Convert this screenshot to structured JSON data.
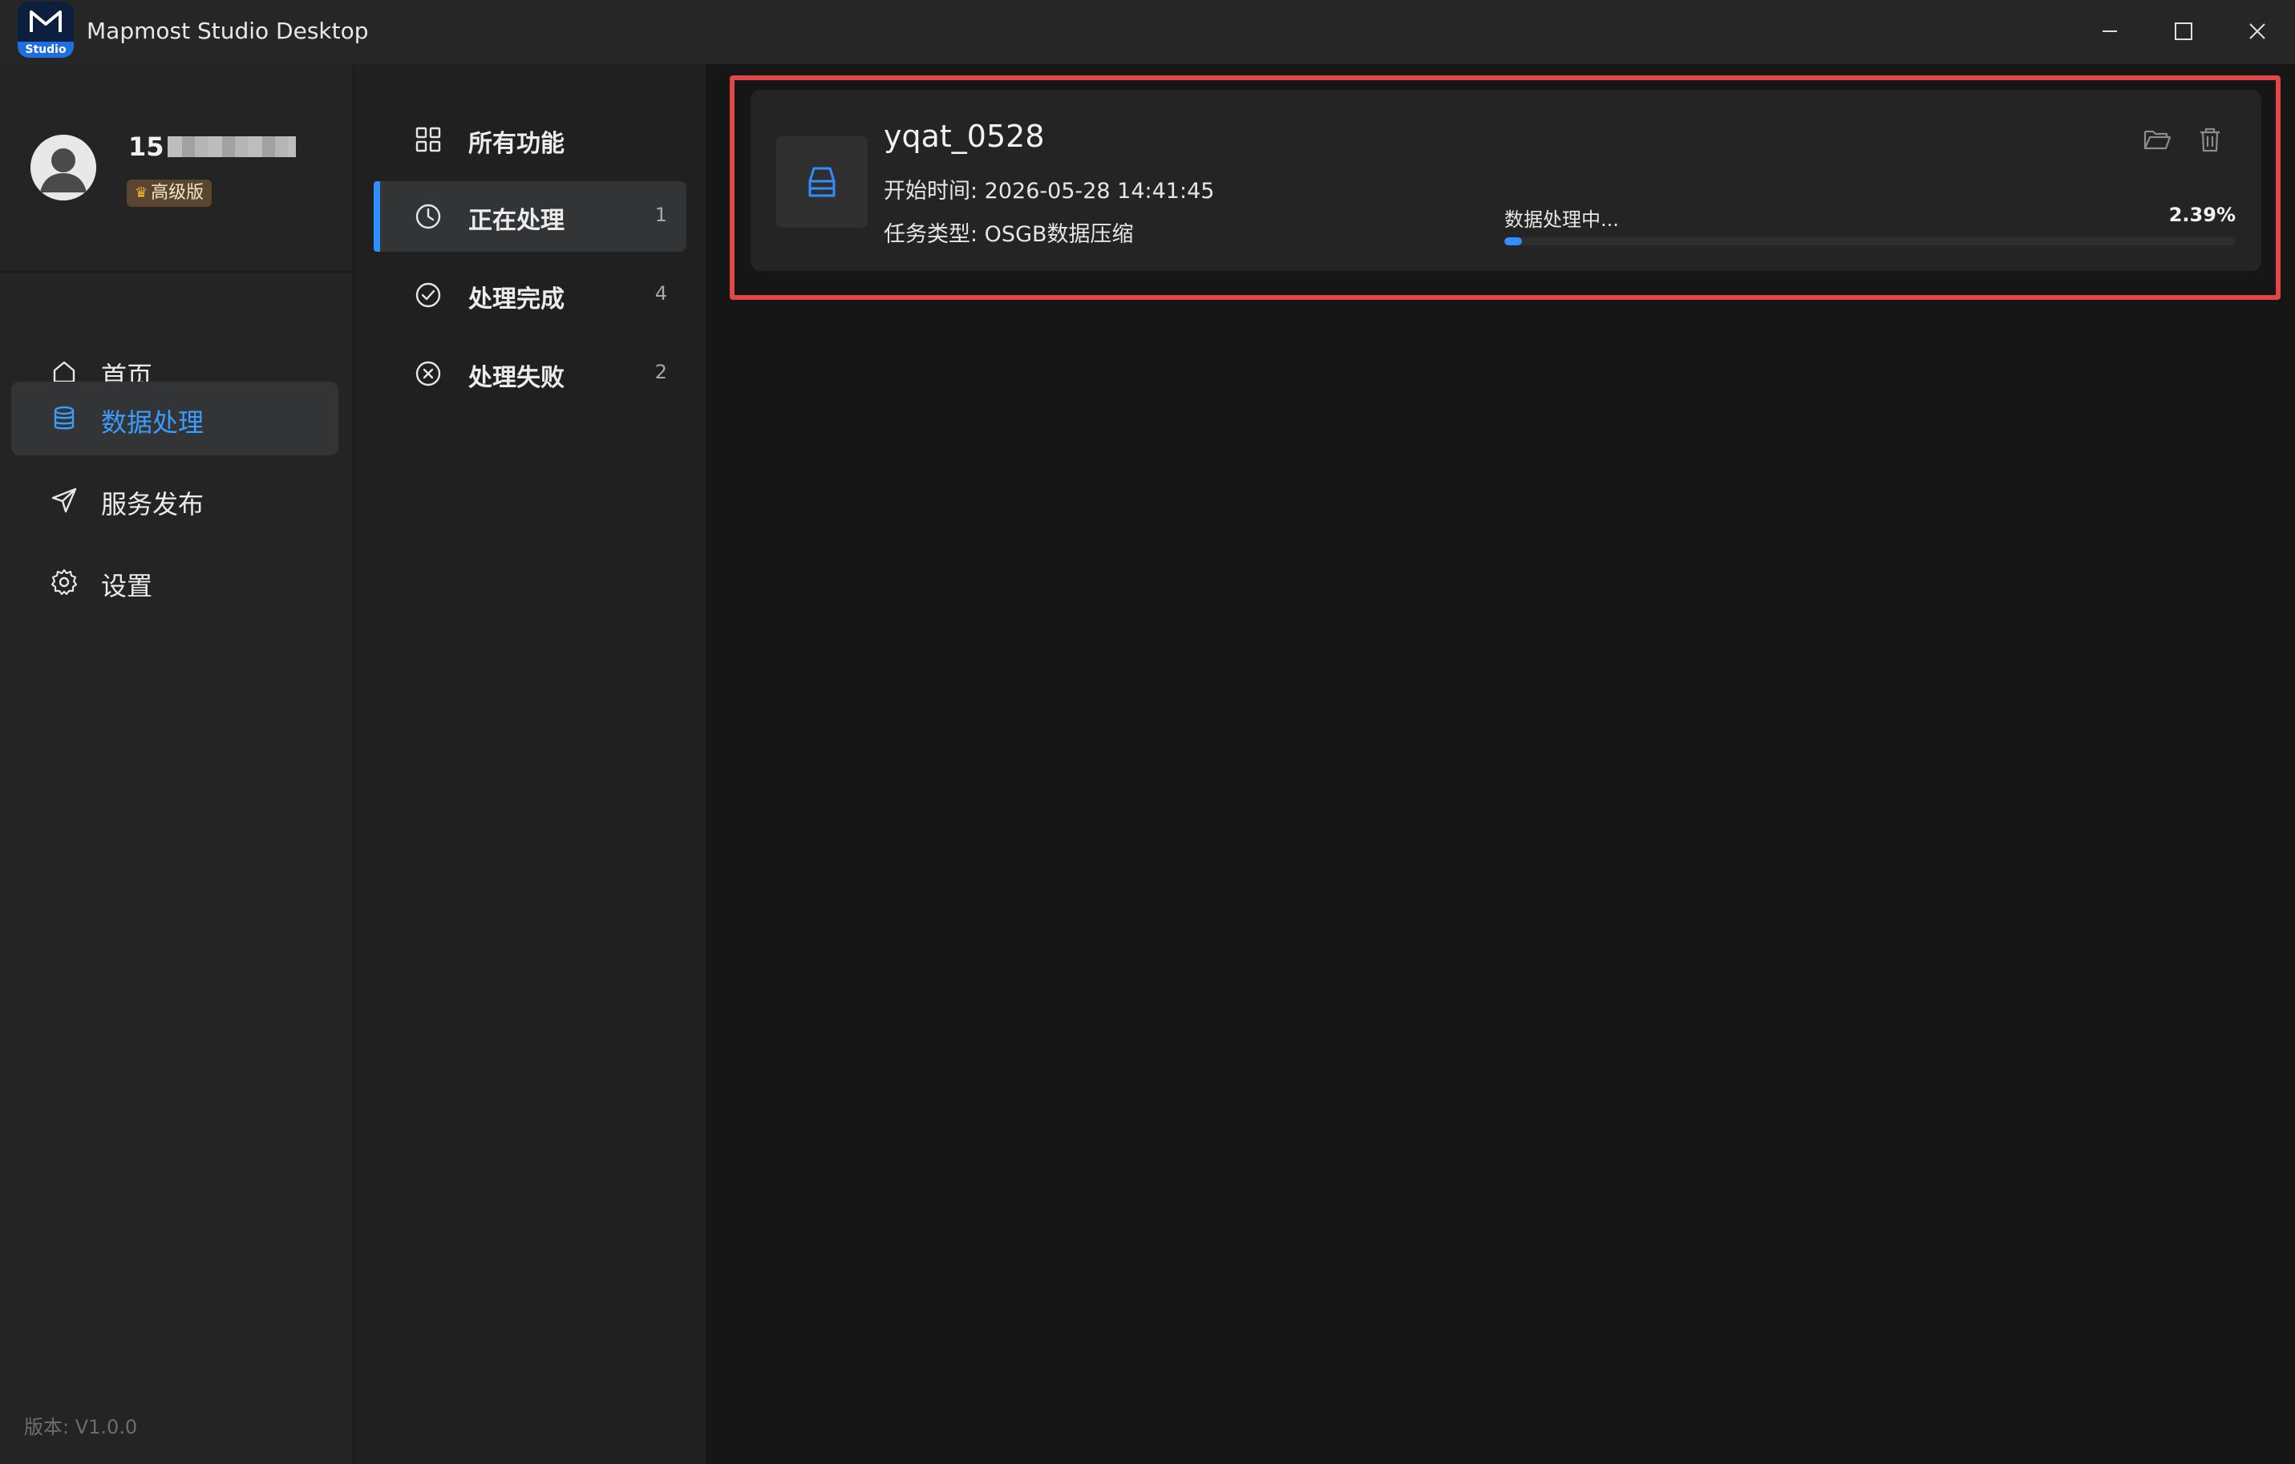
{
  "titlebar": {
    "app_title": "Mapmost Studio Desktop",
    "logo_tag": "Studio"
  },
  "user": {
    "name_prefix": "15",
    "tier_badge": "高级版"
  },
  "sidebar": {
    "items": [
      {
        "label": "首页",
        "icon": "home-icon",
        "active": false
      },
      {
        "label": "数据处理",
        "icon": "database-icon",
        "active": true
      },
      {
        "label": "服务发布",
        "icon": "send-icon",
        "active": false
      },
      {
        "label": "设置",
        "icon": "gear-icon",
        "active": false
      }
    ],
    "version": "版本: V1.0.0"
  },
  "task_filters": {
    "items": [
      {
        "label": "所有功能",
        "count": "",
        "icon": "grid-icon",
        "active": false
      },
      {
        "label": "正在处理",
        "count": "1",
        "icon": "clock-icon",
        "active": true
      },
      {
        "label": "处理完成",
        "count": "4",
        "icon": "check-circle-icon",
        "active": false
      },
      {
        "label": "处理失败",
        "count": "2",
        "icon": "x-circle-icon",
        "active": false
      }
    ]
  },
  "task": {
    "name": "yqat_0528",
    "start_time": "开始时间: 2026-05-28 14:41:45",
    "task_type": "任务类型: OSGB数据压缩",
    "status": "数据处理中...",
    "percent_label": "2.39%",
    "progress": 0.0239
  },
  "colors": {
    "accent": "#2f8fff",
    "highlight_border": "#e04848"
  }
}
